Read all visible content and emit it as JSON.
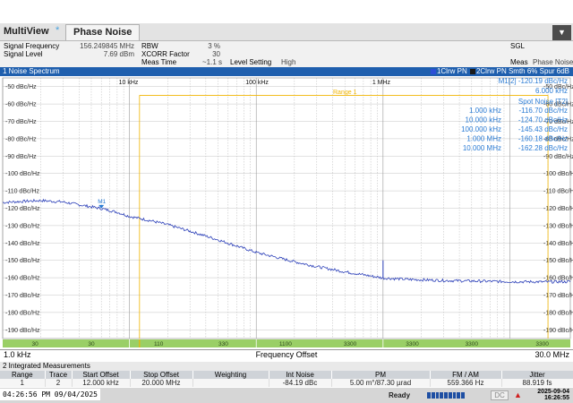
{
  "app": {
    "title": "MultiView",
    "tab_star": "*",
    "active_tab": "Phase Noise",
    "menu_icon": "chevron-down-icon"
  },
  "header": {
    "signal_frequency_label": "Signal Frequency",
    "signal_frequency_value": "156.249845 MHz",
    "signal_level_label": "Signal Level",
    "signal_level_value": "7.69 dBm",
    "rbw_label": "RBW",
    "rbw_value": "3 %",
    "xcorr_label": "XCORR Factor",
    "xcorr_value": "30",
    "meas_time_label": "Meas Time",
    "meas_time_value": "~1.1 s",
    "level_setting_label": "Level Setting",
    "level_setting_value": "High",
    "sgl": "SGL",
    "meas_label": "Meas",
    "meas_value": "Phase Noise"
  },
  "trace_bar": {
    "title": "1 Noise Spectrum",
    "trace1": "1Clrw PN",
    "trace2": "2Clrw PN Smth 6% Spur 6dB",
    "trace1_color": "#2b4fd6",
    "trace2_color": "#1a1a1a"
  },
  "plot": {
    "y_labels": [
      "-50 dBc/Hz",
      "-60 dBc/Hz",
      "-70 dBc/Hz",
      "-80 dBc/Hz",
      "-90 dBc/Hz",
      "-100 dBc/Hz",
      "-110 dBc/Hz",
      "-120 dBc/Hz",
      "-130 dBc/Hz",
      "-140 dBc/Hz",
      "-150 dBc/Hz",
      "-160 dBc/Hz",
      "-170 dBc/Hz",
      "-180 dBc/Hz",
      "-190 dBc/Hz"
    ],
    "decade_labels": [
      "10 kHz",
      "100 kHz",
      "1 MHz"
    ],
    "range_label": "Range 1",
    "marker_label": "M1",
    "marker_readout": "M1[2]  -120.19 dBc/Hz",
    "marker_freq": "6.000 kHz",
    "spot_noise_title": "Spot Noise [T2]",
    "spot_noise": [
      {
        "freq": "1.000 kHz",
        "value": "-116.70 dBc/Hz"
      },
      {
        "freq": "10.000 kHz",
        "value": "-124.70 dBc/Hz"
      },
      {
        "freq": "100.000 kHz",
        "value": "-145.43 dBc/Hz"
      },
      {
        "freq": "1.000 MHz",
        "value": "-160.18 dBc/Hz"
      },
      {
        "freq": "10.000 MHz",
        "value": "-162.28 dBc/Hz"
      }
    ],
    "bottom_strip_labels": [
      "30",
      "30",
      "110",
      "330",
      "1100",
      "3300",
      "3300",
      "3300",
      "3300"
    ],
    "trace_color": "#2b3fb8",
    "grid_color": "#c4c4c4",
    "range_color": "#f0b400",
    "strip_color": "#9acf66"
  },
  "xaxis": {
    "start": "1.0 kHz",
    "label": "Frequency Offset",
    "stop": "30.0 MHz"
  },
  "integrated": {
    "title": "2 Integrated Measurements",
    "columns": [
      "Range",
      "Trace",
      "Start Offset",
      "Stop Offset",
      "Weighting",
      "Int Noise",
      "PM",
      "FM / AM",
      "Jitter"
    ],
    "rows": [
      [
        "1",
        "2",
        "12.000 kHz",
        "20.000 MHz",
        "",
        "-84.19 dBc",
        "5.00 m°/87.30 µrad",
        "559.366 Hz",
        "88.919 fs"
      ]
    ]
  },
  "status": {
    "ready": "Ready",
    "dc": "DC",
    "date": "2025-09-04",
    "time": "16:26:55",
    "os_stamp": "04:26:56 PM  09/04/2025"
  },
  "chart_data": {
    "type": "line",
    "title": "1 Noise Spectrum",
    "xlabel": "Frequency Offset",
    "ylabel": "",
    "x_scale": "log",
    "xlim": [
      1000,
      30000000
    ],
    "ylim": [
      -195,
      -45
    ],
    "grid": true,
    "x": [
      1000,
      1500,
      2000,
      3000,
      4000,
      5000,
      6000,
      8000,
      10000,
      15000,
      20000,
      30000,
      50000,
      100000,
      200000,
      300000,
      500000,
      700000,
      1000000,
      1500000,
      2000000,
      3000000,
      5000000,
      10000000,
      20000000,
      30000000
    ],
    "series": [
      {
        "values": [
          -116.7,
          -116.0,
          -115.6,
          -116.4,
          -118.0,
          -119.2,
          -120.19,
          -122.3,
          -124.7,
          -127.3,
          -129.5,
          -133.2,
          -138.2,
          -145.43,
          -150.8,
          -153.6,
          -156.6,
          -158.3,
          -160.18,
          -160.9,
          -161.2,
          -161.6,
          -161.9,
          -162.28,
          -162.4,
          -162.3
        ]
      }
    ],
    "spur": {
      "x": 1000000,
      "y": -150
    },
    "marker": {
      "name": "M1",
      "x": 6000,
      "y": -120.19
    },
    "range": {
      "name": "Range 1",
      "x_start": 12000,
      "x_stop": 20000000,
      "y": -55
    }
  }
}
